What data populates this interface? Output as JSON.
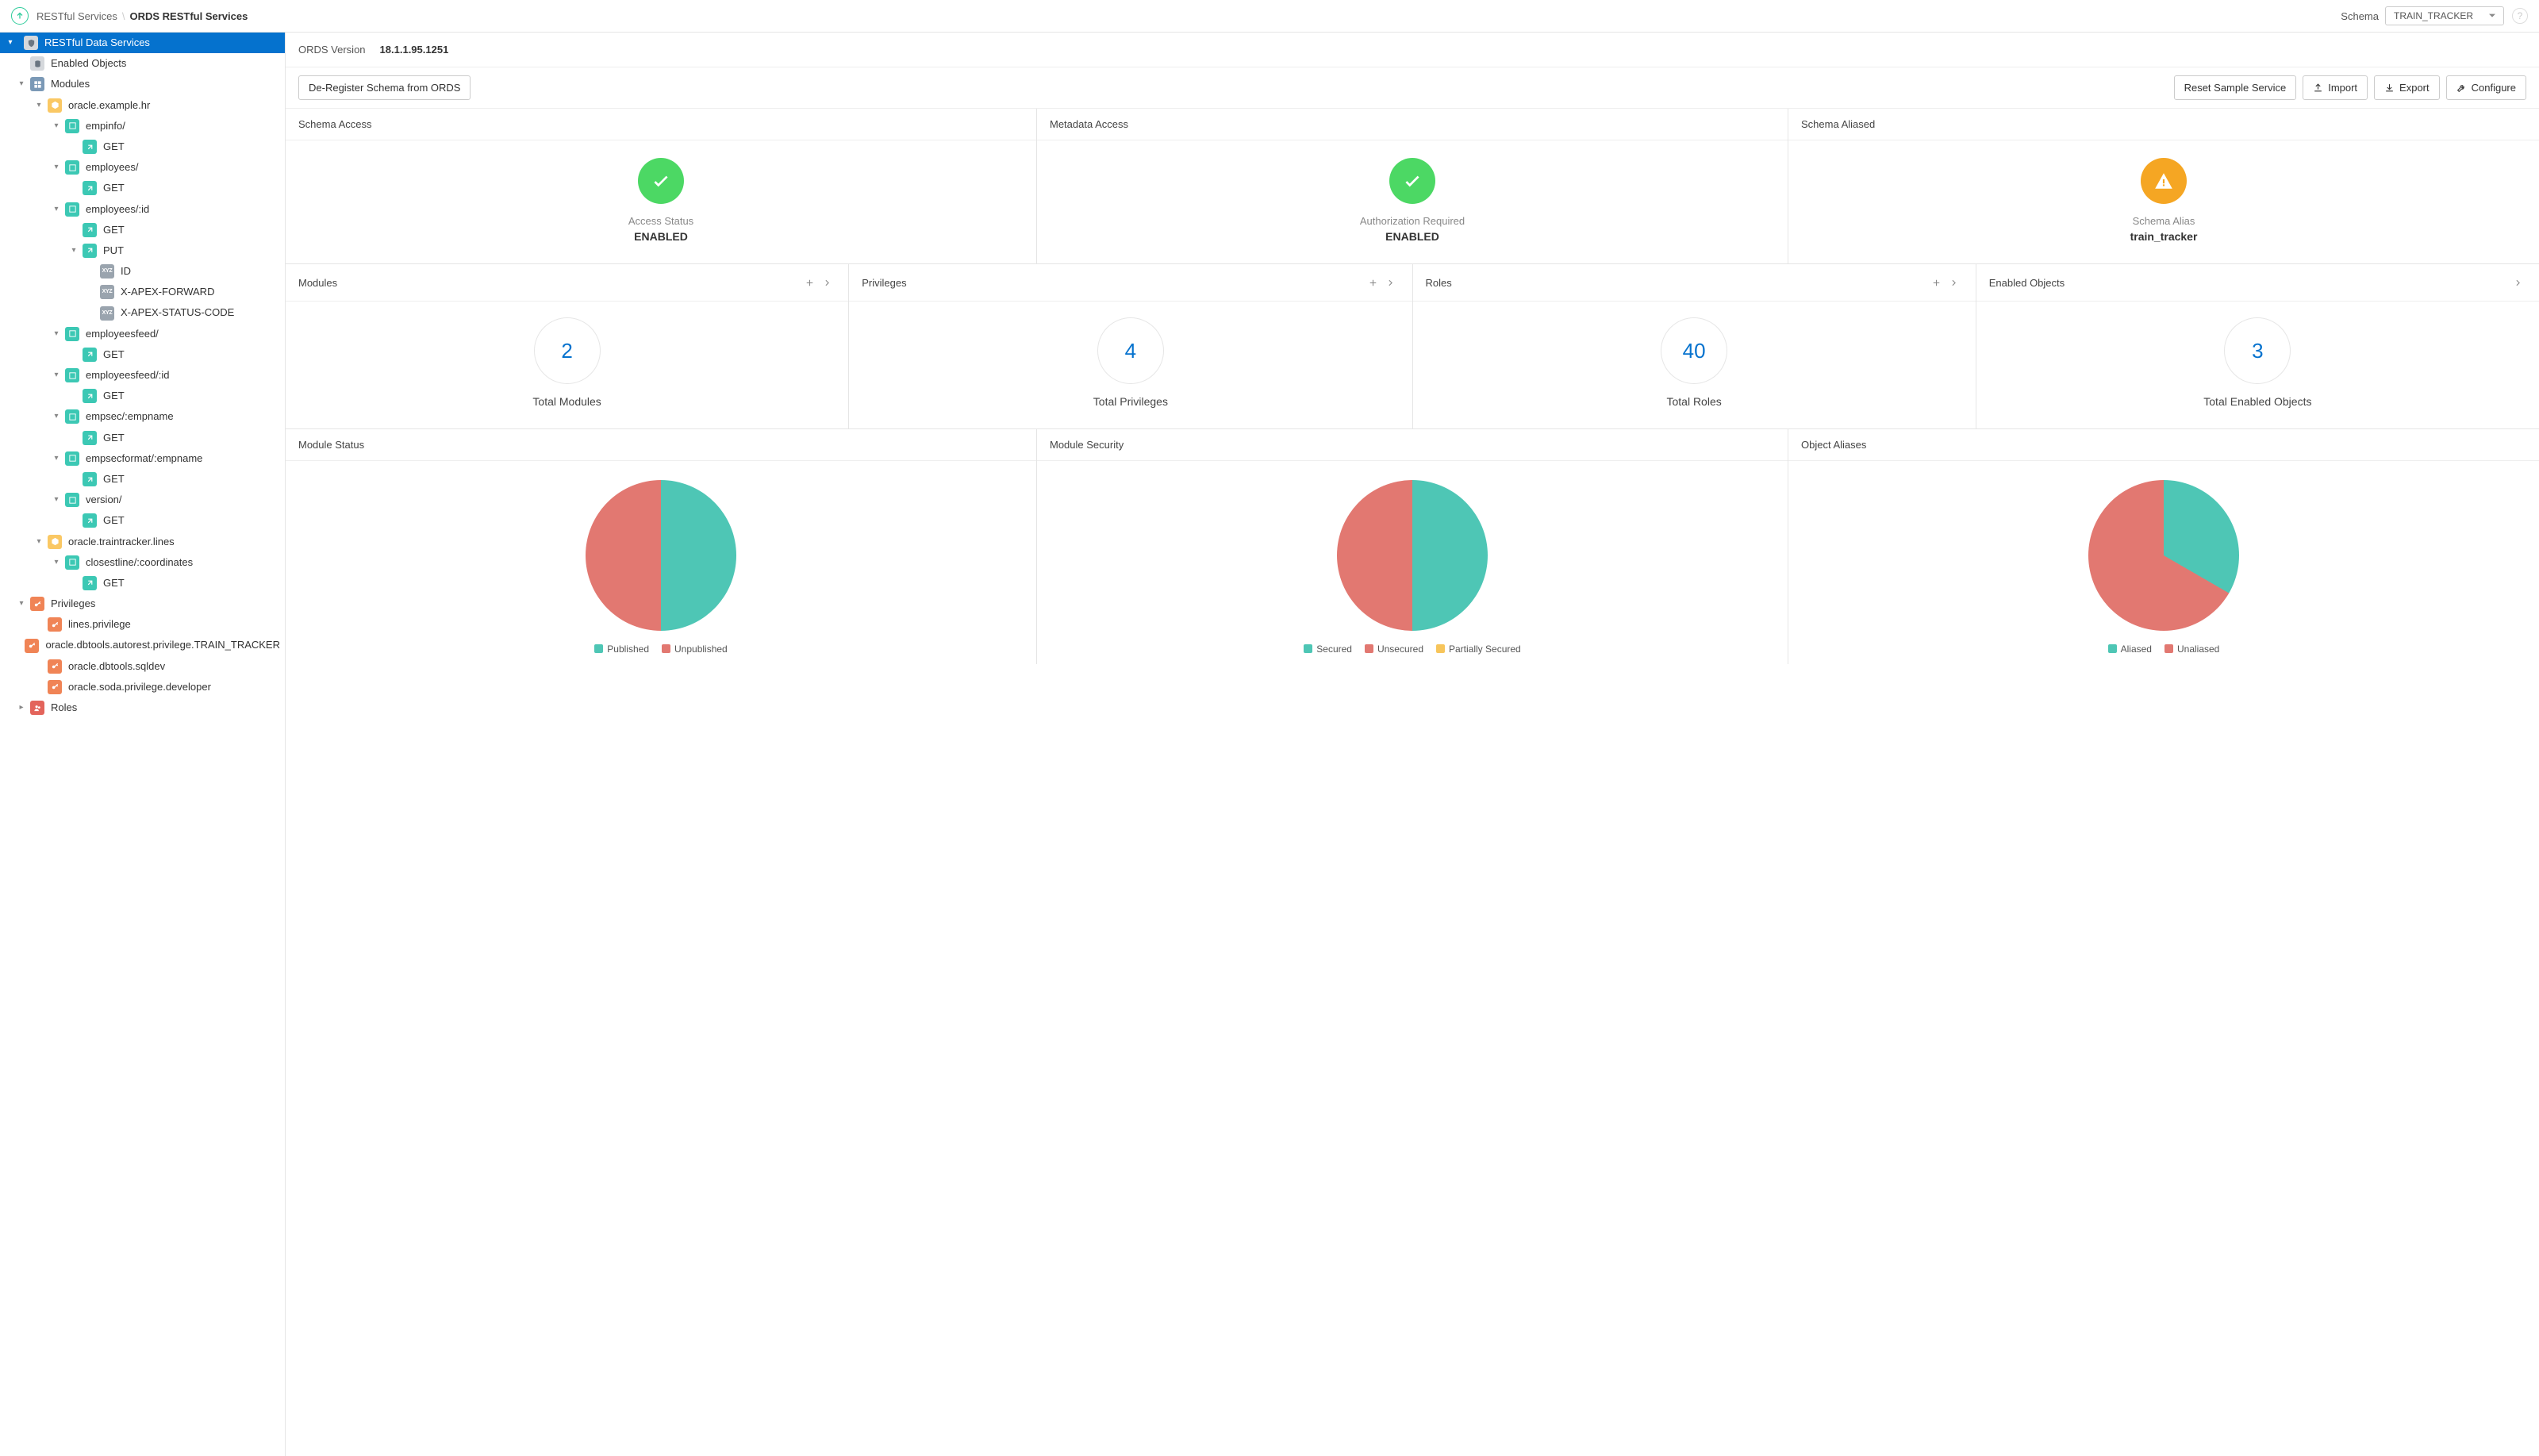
{
  "breadcrumb": {
    "root": "RESTful Services",
    "current": "ORDS RESTful Services"
  },
  "header": {
    "schema_label": "Schema",
    "schema_value": "TRAIN_TRACKER"
  },
  "sidebar": {
    "root": "RESTful Data Services",
    "enabled_objects": "Enabled Objects",
    "modules": "Modules",
    "module_hr": "oracle.example.hr",
    "t_empinfo": "empinfo/",
    "t_employees": "employees/",
    "t_employees_id": "employees/:id",
    "t_employeesfeed": "employeesfeed/",
    "t_employeesfeed_id": "employeesfeed/:id",
    "t_empsec": "empsec/:empname",
    "t_empsecformat": "empsecformat/:empname",
    "t_version": "version/",
    "module_lines": "oracle.traintracker.lines",
    "t_closestline": "closestline/:coordinates",
    "h_get": "GET",
    "h_put": "PUT",
    "p_id": "ID",
    "p_forward": "X-APEX-FORWARD",
    "p_status": "X-APEX-STATUS-CODE",
    "privileges": "Privileges",
    "priv1": "lines.privilege",
    "priv2": "oracle.dbtools.autorest.privilege.TRAIN_TRACKER",
    "priv3": "oracle.dbtools.sqldev",
    "priv4": "oracle.soda.privilege.developer",
    "roles": "Roles"
  },
  "content": {
    "version_label": "ORDS Version",
    "version_value": "18.1.1.95.1251",
    "btn_deregister": "De-Register Schema from ORDS",
    "btn_reset": "Reset Sample Service",
    "btn_import": "Import",
    "btn_export": "Export",
    "btn_configure": "Configure"
  },
  "status": {
    "schema_access_title": "Schema Access",
    "schema_access_sub": "Access Status",
    "schema_access_val": "ENABLED",
    "metadata_title": "Metadata Access",
    "metadata_sub": "Authorization Required",
    "metadata_val": "ENABLED",
    "aliased_title": "Schema Aliased",
    "aliased_sub": "Schema Alias",
    "aliased_val": "train_tracker"
  },
  "counts": {
    "modules_title": "Modules",
    "modules_val": "2",
    "modules_sub": "Total Modules",
    "privileges_title": "Privileges",
    "privileges_val": "4",
    "privileges_sub": "Total Privileges",
    "roles_title": "Roles",
    "roles_val": "40",
    "roles_sub": "Total Roles",
    "enabled_title": "Enabled Objects",
    "enabled_val": "3",
    "enabled_sub": "Total Enabled Objects"
  },
  "charts": {
    "module_status_title": "Module Status",
    "module_security_title": "Module Security",
    "object_aliases_title": "Object Aliases",
    "leg_published": "Published",
    "leg_unpublished": "Unpublished",
    "leg_secured": "Secured",
    "leg_unsecured": "Unsecured",
    "leg_partial": "Partially Secured",
    "leg_aliased": "Aliased",
    "leg_unaliased": "Unaliased"
  },
  "chart_data": [
    {
      "type": "pie",
      "title": "Module Status",
      "series": [
        {
          "name": "Published",
          "value": 1,
          "color": "#4ec6b5"
        },
        {
          "name": "Unpublished",
          "value": 1,
          "color": "#e27871"
        }
      ]
    },
    {
      "type": "pie",
      "title": "Module Security",
      "series": [
        {
          "name": "Secured",
          "value": 1,
          "color": "#4ec6b5"
        },
        {
          "name": "Unsecured",
          "value": 1,
          "color": "#e27871"
        },
        {
          "name": "Partially Secured",
          "value": 0,
          "color": "#f7c55b"
        }
      ]
    },
    {
      "type": "pie",
      "title": "Object Aliases",
      "series": [
        {
          "name": "Aliased",
          "value": 1,
          "color": "#4ec6b5"
        },
        {
          "name": "Unaliased",
          "value": 2,
          "color": "#e27871"
        }
      ]
    }
  ]
}
